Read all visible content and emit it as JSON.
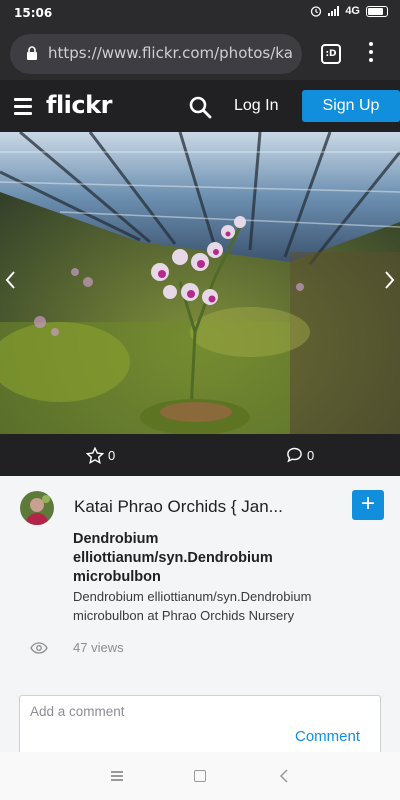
{
  "status_bar": {
    "time": "15:06",
    "network": "4G"
  },
  "browser": {
    "url": "https://www.flickr.com/photos/ka",
    "tab_count": ":D"
  },
  "header": {
    "logo": "flickr",
    "login_label": "Log In",
    "signup_label": "Sign Up"
  },
  "photo": {
    "favorites_count": "0",
    "comments_count": "0"
  },
  "info": {
    "owner_name": "Katai Phrao Orchids { Jan...",
    "add_label": "+",
    "title": "Dendrobium elliottianum/syn.Dendrobium microbulbon",
    "description": "Dendrobium elliottianum/syn.Dendrobium microbulbon at Phrao Orchids Nursery",
    "views": "47 views"
  },
  "comment": {
    "placeholder": "Add a comment",
    "button_label": "Comment"
  },
  "colors": {
    "accent": "#128fdc",
    "dark": "#212124"
  },
  "icons": [
    "alarm-icon",
    "signal-icon",
    "battery-icon",
    "lock-icon",
    "menu-icon",
    "search-icon",
    "star-icon",
    "comment-icon",
    "eye-icon",
    "chevron-left-icon",
    "chevron-right-icon"
  ]
}
